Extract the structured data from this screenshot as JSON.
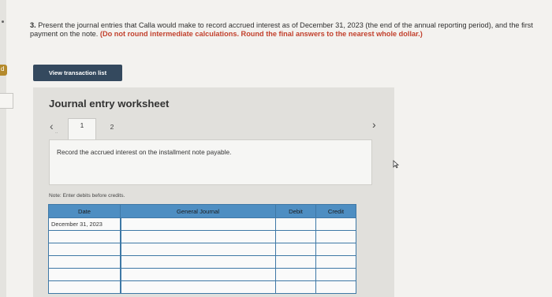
{
  "question": {
    "number": "3.",
    "text": "Present the journal entries that Calla would make to record accrued interest as of December 31, 2023 (the end of the annual reporting period), and the first payment on the note.",
    "warning": "(Do not round intermediate calculations. Round the final answers to the nearest whole dollar.)"
  },
  "left_edge": {
    "tab_label": "d"
  },
  "view_transaction_button": "View transaction list",
  "worksheet": {
    "title": "Journal entry worksheet",
    "prev_icon": "chevron-left-icon",
    "next_icon": "chevron-right-icon",
    "prev_dots": "..",
    "tabs": [
      {
        "label": "1"
      },
      {
        "label": "2"
      }
    ],
    "instruction": "Record the accrued interest on the installment note payable.",
    "note": "Note: Enter debits before credits.",
    "table": {
      "headers": {
        "date": "Date",
        "general_journal": "General Journal",
        "debit": "Debit",
        "credit": "Credit"
      },
      "rows": [
        {
          "date": "December 31, 2023",
          "account": "",
          "debit": "",
          "credit": ""
        },
        {
          "date": "",
          "account": "",
          "debit": "",
          "credit": ""
        },
        {
          "date": "",
          "account": "",
          "debit": "",
          "credit": ""
        },
        {
          "date": "",
          "account": "",
          "debit": "",
          "credit": ""
        },
        {
          "date": "",
          "account": "",
          "debit": "",
          "credit": ""
        },
        {
          "date": "",
          "account": "",
          "debit": "",
          "credit": ""
        }
      ]
    }
  },
  "colors": {
    "header_blue": "#4e8ec2",
    "button_navy": "#34495e",
    "warning_red": "#c2412d"
  },
  "cursor_icon": "mouse-pointer-icon"
}
